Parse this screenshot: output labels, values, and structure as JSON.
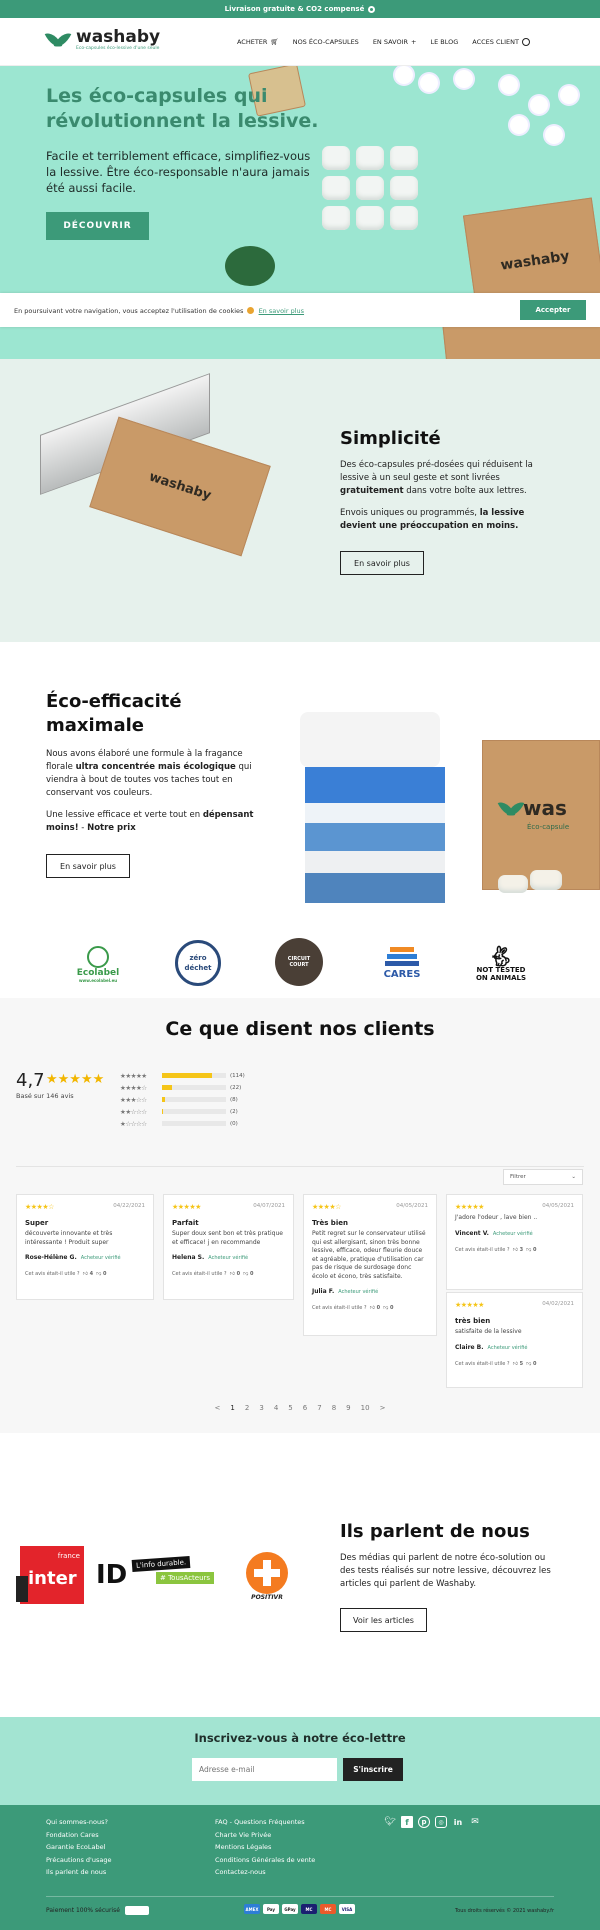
{
  "topbar": {
    "text": "Livraison gratuite & CO2 compensé"
  },
  "header": {
    "logo_name": "washaby",
    "logo_tagline": "Eco-capsules éco-lessive d'une seule",
    "nav": [
      "ACHETER",
      "NOS ÉCO-CAPSULES",
      "EN SAVOIR",
      "LE BLOG",
      "ACCES CLIENT"
    ]
  },
  "hero": {
    "title": "Les éco-capsules qui révolutionnent la lessive.",
    "subtitle": "Facile et terriblement efficace, simplifiez-vous la lessive. Être éco-responsable n'aura jamais été aussi facile.",
    "button": "DÉCOUVRIR",
    "box_text": "washaby"
  },
  "cookie": {
    "text": "En poursuivant votre navigation, vous acceptez l'utilisation de cookies",
    "link": "En savoir plus",
    "button": "Accepter"
  },
  "simplicity": {
    "title": "Simplicité",
    "p1a": "Des éco-capsules pré-dosées qui réduisent la lessive à un seul geste et sont livrées ",
    "p1b": "gratuitement",
    "p1c": " dans votre boîte aux lettres.",
    "p2a": "Envois uniques ou programmés, ",
    "p2b": "la lessive devient une préoccupation en moins.",
    "button": "En savoir plus",
    "box_text": "washaby"
  },
  "eco": {
    "title": "Éco-efficacité maximale",
    "p1a": "Nous avons élaboré une formule à la fragance florale ",
    "p1b": "ultra concentrée mais écologique",
    "p1c": " qui viendra à bout de toutes vos taches tout en conservant vos couleurs.",
    "p2a": "Une lessive efficace et verte tout en ",
    "p2b": "dépensant moins!",
    "p2c": " - ",
    "p2d": "Notre prix",
    "button": "En savoir plus",
    "box_text": "was",
    "box_sub": "Éco-capsule"
  },
  "labels": [
    {
      "name": "Ecolabel",
      "sub": "www.ecolabel.eu"
    },
    {
      "name": "zéro déchet"
    },
    {
      "name": "CIRCUIT COURT"
    },
    {
      "name": "CARES"
    },
    {
      "name": "NOT TESTED ON ANIMALS"
    }
  ],
  "reviews": {
    "title": "Ce que disent nos clients",
    "average": "4,7",
    "stars": "★★★★★",
    "based": "Basé sur 146 avis",
    "bars": [
      {
        "stars": "★★★★★",
        "count": "(114)",
        "pct": 0.78
      },
      {
        "stars": "★★★★☆",
        "count": "(22)",
        "pct": 0.15
      },
      {
        "stars": "★★★☆☆",
        "count": "(8)",
        "pct": 0.05
      },
      {
        "stars": "★★☆☆☆",
        "count": "(2)",
        "pct": 0.01
      },
      {
        "stars": "★☆☆☆☆",
        "count": "(0)",
        "pct": 0
      }
    ],
    "filter": "Filtrer",
    "useful": "Cet avis était-il utile ?",
    "verified": "Acheteur vérifié",
    "items": [
      {
        "stars": "★★★★☆",
        "date": "04/22/2021",
        "title": "Super",
        "body": "découverte innovante et très intéressante ! Produit super",
        "author": "Rose-Hélène G.",
        "up": "4",
        "down": "0"
      },
      {
        "stars": "★★★★★",
        "date": "04/07/2021",
        "title": "Parfait",
        "body": "Super doux sent bon et très pratique et efficace! j en recommande",
        "author": "Helena S.",
        "up": "0",
        "down": "0"
      },
      {
        "stars": "★★★★☆",
        "date": "04/05/2021",
        "title": "Très bien",
        "body": "Petit regret sur le conservateur utilisé qui est allergisant, sinon très bonne lessive, efficace, odeur fleurie douce et agréable, pratique d'utilisation car pas de risque de surdosage donc écolo et écono, très satisfaite.",
        "author": "Julia F.",
        "up": "0",
        "down": "0"
      },
      {
        "stars": "★★★★★",
        "date": "04/05/2021",
        "title": "",
        "body": "J'adore l'odeur , lave bien ..",
        "author": "Vincent V.",
        "up": "3",
        "down": "0"
      },
      {
        "stars": "★★★★★",
        "date": "04/02/2021",
        "title": "très bien",
        "body": "satisfaite de la lessive",
        "author": "Claire B.",
        "up": "5",
        "down": "0"
      }
    ],
    "pages": [
      "<",
      "1",
      "2",
      "3",
      "4",
      "5",
      "6",
      "7",
      "8",
      "9",
      "10",
      ">"
    ]
  },
  "press": {
    "title": "Ils parlent de nous",
    "body": "Des médias qui parlent de notre éco-solution ou des tests réalisés sur notre lessive, découvrez les articles qui parlent de Washaby.",
    "button": "Voir les articles",
    "logos": {
      "fi_top": "france",
      "fi_main": "inter",
      "id_text": "L'info durable.",
      "id_tag": "# TousActeurs",
      "positivr": "POSITIVR"
    }
  },
  "newsletter": {
    "title": "Inscrivez-vous à notre éco-lettre",
    "placeholder": "Adresse e-mail",
    "button": "S'inscrire"
  },
  "footer": {
    "col1": [
      "Qui sommes-nous?",
      "Fondation Cares",
      "Garantie EcoLabel",
      "Précautions d'usage",
      "Ils parlent de nous"
    ],
    "col2": [
      "FAQ - Questions Fréquentes",
      "Charte Vie Privée",
      "Mentions Légales",
      "Conditions Générales de vente",
      "Contactez-nous"
    ],
    "payment": "Paiement 100% sécurisé",
    "rights": "Tous droits réservés © 2021 washaby.fr",
    "cards": [
      "AMEX",
      "Pay",
      "GPay",
      "MC",
      "MC",
      "VISA"
    ]
  }
}
